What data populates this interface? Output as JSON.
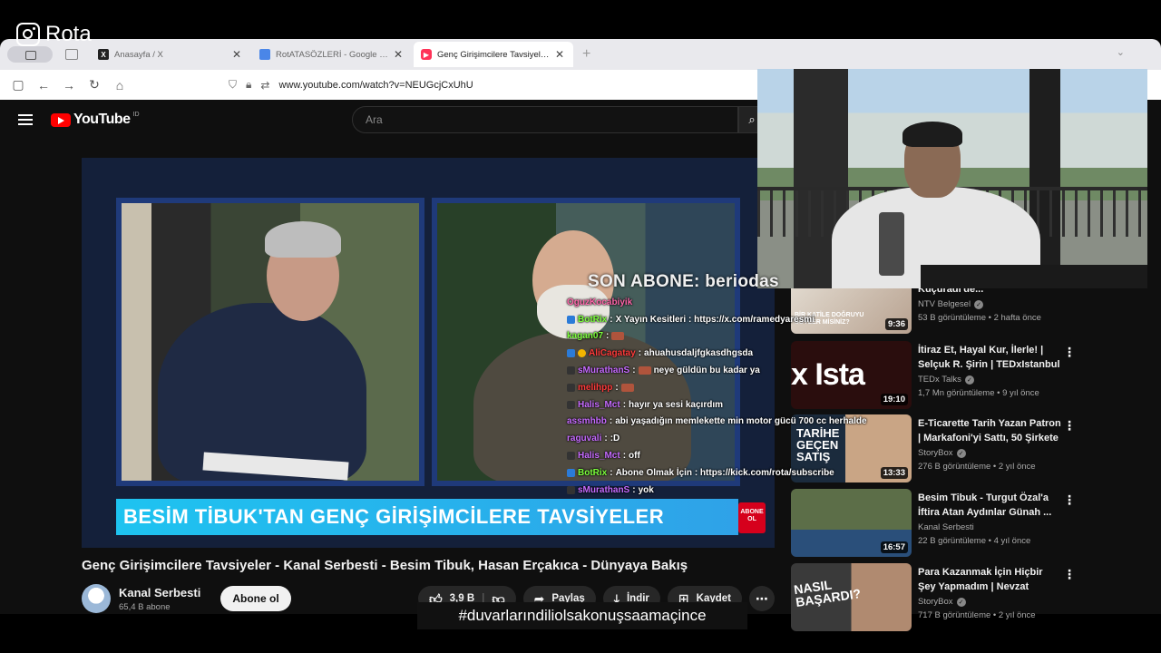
{
  "overlay": {
    "brand": "Rota",
    "last_sub": "SON ABONE: beriodas",
    "hashtag": "#duvarlarındiliolsakonuşsaamaçince"
  },
  "browser": {
    "tabs": [
      {
        "label": "Anasayfa / X",
        "favicon": "X",
        "active": false
      },
      {
        "label": "RotATASÖZLERİ - Google Dokümanlar",
        "favicon": "docs",
        "active": false
      },
      {
        "label": "Genç Girişimcilere Tavsiyeler - Kanal Serbesti",
        "favicon": "youtube",
        "active": true
      }
    ],
    "url": "www.youtube.com/watch?v=NEUGcjCxUhU"
  },
  "youtube": {
    "logo": "YouTube",
    "region": "ID",
    "search_placeholder": "Ara",
    "banner_text": "BESİM TİBUK'TAN GENÇ GİRİŞİMCİLERE TAVSİYELER",
    "badge_text": "ABONE OL",
    "video_title": "Genç Girişimcilere Tavsiyeler - Kanal Serbesti - Besim Tibuk, Hasan Erçakıca - Dünyaya Bakış",
    "channel": {
      "name": "Kanal Serbesti",
      "subs": "65,4 B abone",
      "subscribe_label": "Abone ol"
    },
    "actions": {
      "likes": "3,9 B",
      "share": "Paylaş",
      "download": "İndir",
      "save": "Kaydet"
    },
    "sidebar": [
      {
        "title": "İzin Verir? Yoanna Kuçuradi'de...",
        "channel": "NTV Belgesel",
        "verified": true,
        "meta": "53 B görüntüleme • 2 hafta önce",
        "duration": "9:36",
        "thumb_text": "BİR KATİLE DOĞRUYU SÖYLER MİSİNİZ?"
      },
      {
        "title": "İtiraz Et, Hayal Kur, İlerle! | Selçuk R. Şirin | TEDxIstanbul",
        "channel": "TEDx Talks",
        "verified": true,
        "meta": "1,7 Mn görüntüleme • 9 yıl önce",
        "duration": "19:10",
        "thumb_text": "x Ista"
      },
      {
        "title": "E-Ticarette Tarih Yazan Patron | Markafoni'yi Sattı, 50 Şirkete ...",
        "channel": "StoryBox",
        "verified": true,
        "meta": "276 B görüntüleme • 2 yıl önce",
        "duration": "13:33",
        "thumb_text": "TARİHE GEÇEN SATIŞ"
      },
      {
        "title": "Besim Tibuk - Turgut Özal'a İftira Atan Aydınlar Günah ...",
        "channel": "Kanal Serbesti",
        "verified": false,
        "meta": "22 B görüntüleme • 4 yıl önce",
        "duration": "16:57",
        "thumb_text": ""
      },
      {
        "title": "Para Kazanmak İçin Hiçbir Şey Yapmadım | Nevzat Aydın'ın ...",
        "channel": "StoryBox",
        "verified": true,
        "meta": "717 B görüntüleme • 2 yıl önce",
        "duration": "",
        "thumb_text": "NASIL BAŞARDI?"
      }
    ]
  },
  "chat": [
    {
      "user": "OguzKocabiyik",
      "text": "",
      "color": "#ff66aa"
    },
    {
      "user": "BotRix",
      "text": "X Yayın Kesitleri : https://x.com/ramedyaresmi",
      "color": "#7cff3c"
    },
    {
      "user": "kagan07",
      "text": "",
      "color": "#7cff3c"
    },
    {
      "user": "AliCagatay",
      "text": "ahuahusdaljfgkasdhgsda",
      "color": "#ff3b3b"
    },
    {
      "user": "sMurathanS",
      "text": "neye güldün bu kadar ya",
      "color": "#c66bff"
    },
    {
      "user": "melihpp",
      "text": "",
      "color": "#ff3b3b"
    },
    {
      "user": "Halis_Mct",
      "text": "hayır ya sesi kaçırdım",
      "color": "#c66bff"
    },
    {
      "user": "assmhbb",
      "text": "abi yaşadığın memlekette min motor gücü 700 cc herhalde",
      "color": "#c66bff"
    },
    {
      "user": "raguvali",
      "text": ":D",
      "color": "#c66bff"
    },
    {
      "user": "Halis_Mct",
      "text": "off",
      "color": "#c66bff"
    },
    {
      "user": "BotRix",
      "text": "Abone Olmak İçin : https://kick.com/rota/subscribe",
      "color": "#7cff3c"
    },
    {
      "user": "sMurathanS",
      "text": "yok",
      "color": "#c66bff"
    }
  ]
}
